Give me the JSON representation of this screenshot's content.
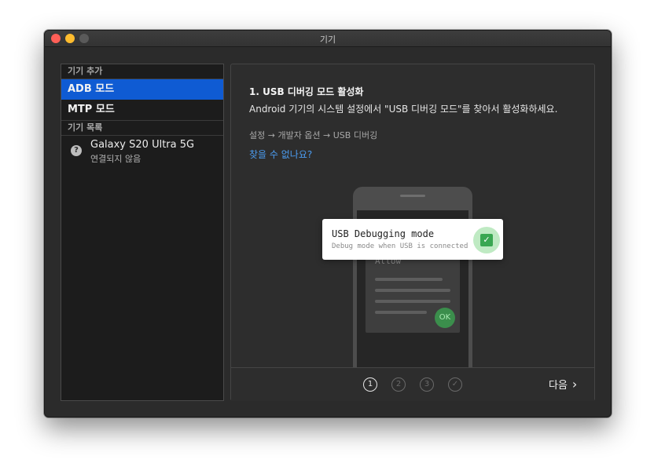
{
  "window": {
    "title": "기기"
  },
  "sidebar": {
    "add_header": "기기 추가",
    "modes": [
      {
        "label": "ADB 모드",
        "selected": true
      },
      {
        "label": "MTP 모드",
        "selected": false
      }
    ],
    "list_header": "기기 목록",
    "devices": [
      {
        "name": "Galaxy S20 Ultra 5G",
        "status": "연결되지 않음",
        "icon": "question-icon"
      }
    ]
  },
  "main": {
    "step_title": "1. USB 디버깅 모드 활성화",
    "step_description": "Android 기기의 시스템 설정에서 \"USB 디버깅 모드\"를 찾아서 활성화하세요.",
    "settings_path": "설정  → 개발자 옵션 → USB 디버깅",
    "help_link": "찾을 수 없나요?",
    "illustration": {
      "toast_title": "USB Debugging mode",
      "toast_subtitle": "Debug mode when USB is connected",
      "dialog_allow": "Allow",
      "dialog_ok": "OK"
    }
  },
  "footer": {
    "steps": [
      {
        "label": "1",
        "active": true
      },
      {
        "label": "2",
        "active": false
      },
      {
        "label": "3",
        "active": false
      },
      {
        "label": "✓",
        "active": false
      }
    ],
    "next_label": "다음"
  },
  "colors": {
    "accent": "#0f5bd3",
    "link": "#4b9cf0",
    "success": "#3aa752"
  }
}
